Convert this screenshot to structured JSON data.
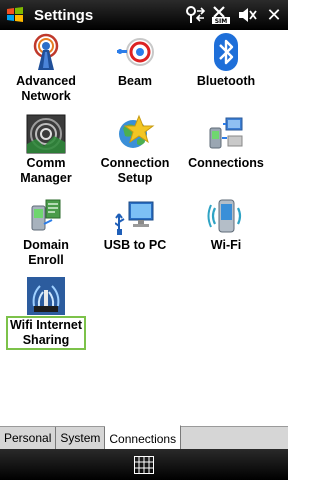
{
  "titlebar": {
    "title": "Settings",
    "start_icon": "windows-flag-icon",
    "status_icons": [
      "connectivity-icon",
      "no-sim-icon",
      "volume-muted-icon"
    ],
    "close_label": "✕"
  },
  "items": [
    {
      "label": "Advanced\nNetwork",
      "icon": "advanced-network-icon"
    },
    {
      "label": "Beam",
      "icon": "beam-icon"
    },
    {
      "label": "Bluetooth",
      "icon": "bluetooth-icon"
    },
    {
      "label": "Comm\nManager",
      "icon": "comm-manager-icon"
    },
    {
      "label": "Connection\nSetup",
      "icon": "connection-setup-icon"
    },
    {
      "label": "Connections",
      "icon": "connections-icon"
    },
    {
      "label": "Domain\nEnroll",
      "icon": "domain-enroll-icon"
    },
    {
      "label": "USB to PC",
      "icon": "usb-to-pc-icon"
    },
    {
      "label": "Wi-Fi",
      "icon": "wifi-icon"
    },
    {
      "label": "Wifi Internet\nSharing",
      "icon": "wifi-internet-sharing-icon",
      "selected": true
    }
  ],
  "tabs": [
    {
      "label": "Personal",
      "active": false
    },
    {
      "label": "System",
      "active": false
    },
    {
      "label": "Connections",
      "active": true
    }
  ],
  "softbar": {
    "keyboard_icon": "keyboard-icon"
  },
  "colors": {
    "selection_outline": "#7cc24a",
    "titlebar_bg": "#000000"
  }
}
